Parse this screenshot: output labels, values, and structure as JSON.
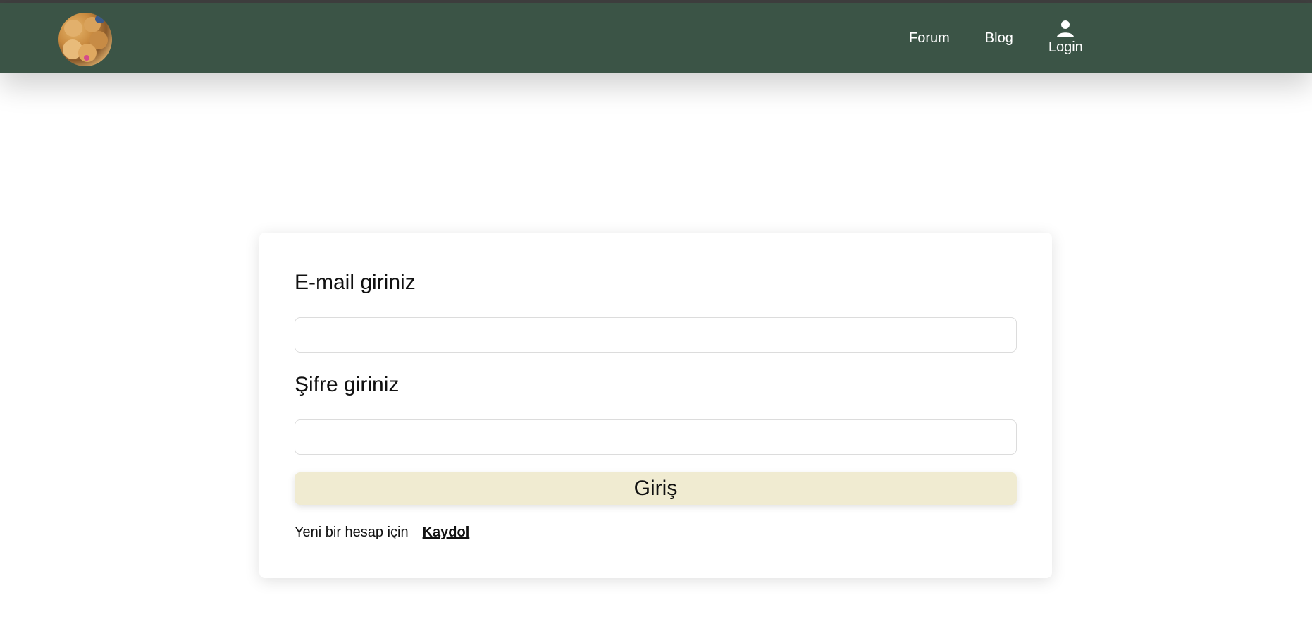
{
  "navbar": {
    "logo_alt": "puppies logo",
    "links": [
      {
        "label": "Forum"
      },
      {
        "label": "Blog"
      }
    ],
    "login_label": "Login",
    "background": "#3b5446"
  },
  "login_form": {
    "email_label": "E-mail giriniz",
    "email_value": "",
    "password_label": "Şifre giriniz",
    "password_value": "",
    "submit_label": "Giriş",
    "register_prompt": "Yeni bir hesap için",
    "register_link": "Kaydol",
    "button_color": "#f0ebd1"
  },
  "icons": {
    "user": "user-icon",
    "logo": "logo-image"
  }
}
